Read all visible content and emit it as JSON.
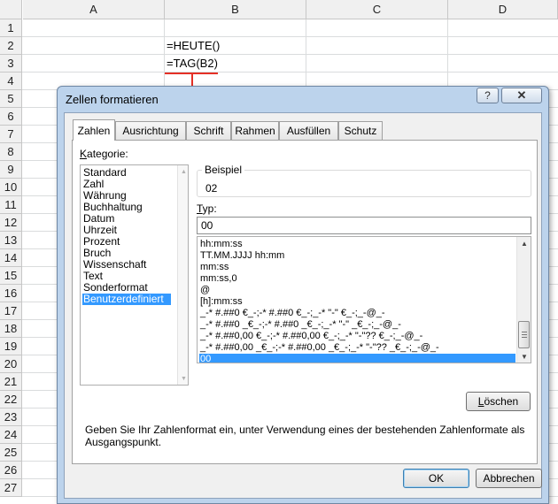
{
  "spreadsheet": {
    "columns": [
      "A",
      "B",
      "C",
      "D"
    ],
    "rows": [
      "1",
      "2",
      "3",
      "4",
      "5",
      "6",
      "7",
      "8",
      "9",
      "10",
      "11",
      "12",
      "13",
      "14",
      "15",
      "16",
      "17",
      "18",
      "19",
      "20",
      "21",
      "22",
      "23",
      "24",
      "25",
      "26",
      "27"
    ],
    "cells": {
      "B2": "=HEUTE()",
      "B3": "=TAG(B2)"
    },
    "annotation_color": "#e53026"
  },
  "dialog": {
    "title": "Zellen formatieren",
    "help_label": "?",
    "close_label": "✕",
    "tabs": [
      "Zahlen",
      "Ausrichtung",
      "Schrift",
      "Rahmen",
      "Ausfüllen",
      "Schutz"
    ],
    "active_tab": "Zahlen",
    "category": {
      "label_first": "K",
      "label_rest": "ategorie:",
      "items": [
        "Standard",
        "Zahl",
        "Währung",
        "Buchhaltung",
        "Datum",
        "Uhrzeit",
        "Prozent",
        "Bruch",
        "Wissenschaft",
        "Text",
        "Sonderformat",
        "Benutzerdefiniert"
      ],
      "selected": "Benutzerdefiniert"
    },
    "sample": {
      "label": "Beispiel",
      "value": "02"
    },
    "type": {
      "label_first": "T",
      "label_rest": "yp:",
      "value": "00"
    },
    "format_list": {
      "items": [
        "hh:mm:ss",
        "TT.MM.JJJJ hh:mm",
        "mm:ss",
        "mm:ss,0",
        "@",
        "[h]:mm:ss",
        "_-* #.##0 €_-;-* #.##0 €_-;_-* \"-\" €_-;_-@_-",
        "_-* #.##0 _€_-;-* #.##0 _€_-;_-* \"-\" _€_-;_-@_-",
        "_-* #.##0,00 €_-;-* #.##0,00 €_-;_-* \"-\"?? €_-;_-@_-",
        "_-* #.##0,00 _€_-;-* #.##0,00 _€_-;_-* \"-\"?? _€_-;_-@_-",
        "00"
      ],
      "selected": "00"
    },
    "delete_button": {
      "first": "L",
      "rest": "öschen"
    },
    "hint": "Geben Sie Ihr Zahlenformat ein, unter Verwendung eines der bestehenden Zahlenformate als Ausgangspunkt.",
    "ok_label": "OK",
    "cancel_label": "Abbrechen",
    "selection_color": "#3399ff"
  }
}
